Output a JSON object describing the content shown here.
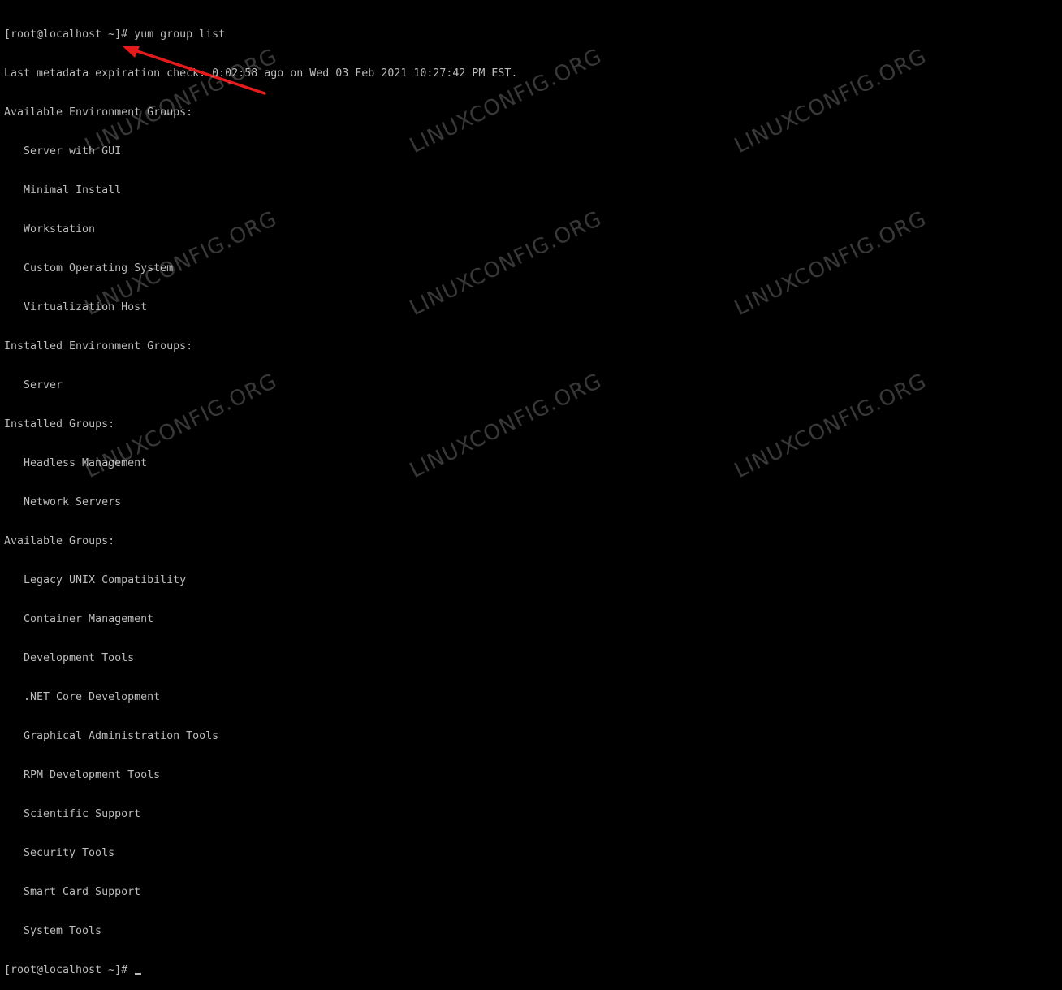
{
  "terminal": {
    "prompt_line": "[root@localhost ~]# yum group list",
    "metadata_line": "Last metadata expiration check: 0:02:58 ago on Wed 03 Feb 2021 10:27:42 PM EST.",
    "available_env_header": "Available Environment Groups:",
    "available_env_groups": [
      "Server with GUI",
      "Minimal Install",
      "Workstation",
      "Custom Operating System",
      "Virtualization Host"
    ],
    "installed_env_header": "Installed Environment Groups:",
    "installed_env_groups": [
      "Server"
    ],
    "installed_groups_header": "Installed Groups:",
    "installed_groups": [
      "Headless Management",
      "Network Servers"
    ],
    "available_groups_header": "Available Groups:",
    "available_groups": [
      "Legacy UNIX Compatibility",
      "Container Management",
      "Development Tools",
      ".NET Core Development",
      "Graphical Administration Tools",
      "RPM Development Tools",
      "Scientific Support",
      "Security Tools",
      "Smart Card Support",
      "System Tools"
    ],
    "final_prompt": "[root@localhost ~]# "
  },
  "watermark": {
    "text": "LINUXCONFIG.ORG",
    "color": "#ffffff"
  },
  "annotation": {
    "arrow_color": "#e31b1b",
    "arrow_icon": "red-arrow-icon"
  },
  "colors": {
    "background": "#000000",
    "text": "#bcbcbc"
  }
}
